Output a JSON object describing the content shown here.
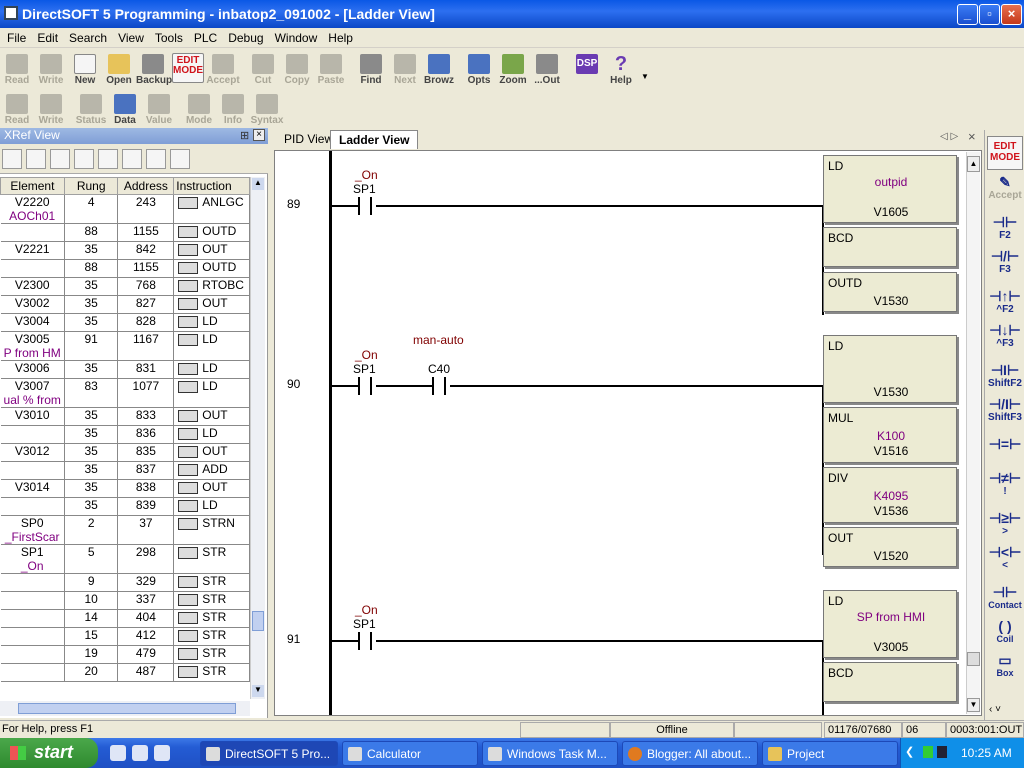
{
  "window": {
    "title": "DirectSOFT 5 Programming - inbatop2_091002 - [Ladder View]",
    "buttons": [
      "_",
      "▫",
      "×"
    ]
  },
  "menu": [
    "File",
    "Edit",
    "Search",
    "View",
    "Tools",
    "PLC",
    "Debug",
    "Window",
    "Help"
  ],
  "toolbar1": [
    {
      "label": "Read",
      "enabled": false
    },
    {
      "label": "Write",
      "enabled": false
    },
    {
      "label": "New",
      "enabled": true
    },
    {
      "label": "Open",
      "enabled": true
    },
    {
      "label": "Backup",
      "enabled": true
    },
    {
      "label": "EDIT MODE",
      "enabled": true
    },
    {
      "label": "Accept",
      "enabled": false
    },
    {
      "label": "Cut",
      "enabled": false
    },
    {
      "label": "Copy",
      "enabled": false
    },
    {
      "label": "Paste",
      "enabled": false
    },
    {
      "label": "Find",
      "enabled": true
    },
    {
      "label": "Next",
      "enabled": false
    },
    {
      "label": "Browz",
      "enabled": true
    },
    {
      "label": "Opts",
      "enabled": true
    },
    {
      "label": "Zoom",
      "enabled": true
    },
    {
      "label": "...Out",
      "enabled": true
    },
    {
      "label": "DSP",
      "enabled": true
    },
    {
      "label": "Help",
      "enabled": true
    }
  ],
  "toolbar2": [
    {
      "label": "Read",
      "enabled": false
    },
    {
      "label": "Write",
      "enabled": false
    },
    {
      "label": "Status",
      "enabled": false
    },
    {
      "label": "Data",
      "enabled": true
    },
    {
      "label": "Value",
      "enabled": false
    },
    {
      "label": "Mode",
      "enabled": false
    },
    {
      "label": "Info",
      "enabled": false
    },
    {
      "label": "Syntax",
      "enabled": false
    }
  ],
  "xref": {
    "title": "XRef View",
    "columns": [
      "Element",
      "Rung",
      "Address",
      "Instruction"
    ],
    "rows": [
      {
        "element": "V2220",
        "nick": "AOCh01",
        "rung": "4",
        "addr": "243",
        "instr": "ANLGC"
      },
      {
        "element": "",
        "nick": "",
        "rung": "88",
        "addr": "1155",
        "instr": "OUTD"
      },
      {
        "element": "V2221",
        "nick": "",
        "rung": "35",
        "addr": "842",
        "instr": "OUT"
      },
      {
        "element": "",
        "nick": "",
        "rung": "88",
        "addr": "1155",
        "instr": "OUTD"
      },
      {
        "element": "V2300",
        "nick": "",
        "rung": "35",
        "addr": "768",
        "instr": "RTOBC"
      },
      {
        "element": "V3002",
        "nick": "",
        "rung": "35",
        "addr": "827",
        "instr": "OUT"
      },
      {
        "element": "V3004",
        "nick": "",
        "rung": "35",
        "addr": "828",
        "instr": "LD"
      },
      {
        "element": "V3005",
        "nick": "P from HM",
        "rung": "91",
        "addr": "1167",
        "instr": "LD"
      },
      {
        "element": "V3006",
        "nick": "",
        "rung": "35",
        "addr": "831",
        "instr": "LD"
      },
      {
        "element": "V3007",
        "nick": "ual % from",
        "rung": "83",
        "addr": "1077",
        "instr": "LD"
      },
      {
        "element": "V3010",
        "nick": "",
        "rung": "35",
        "addr": "833",
        "instr": "OUT"
      },
      {
        "element": "",
        "nick": "",
        "rung": "35",
        "addr": "836",
        "instr": "LD"
      },
      {
        "element": "V3012",
        "nick": "",
        "rung": "35",
        "addr": "835",
        "instr": "OUT"
      },
      {
        "element": "",
        "nick": "",
        "rung": "35",
        "addr": "837",
        "instr": "ADD"
      },
      {
        "element": "V3014",
        "nick": "",
        "rung": "35",
        "addr": "838",
        "instr": "OUT"
      },
      {
        "element": "",
        "nick": "",
        "rung": "35",
        "addr": "839",
        "instr": "LD"
      },
      {
        "element": "SP0",
        "nick": "_FirstScar",
        "rung": "2",
        "addr": "37",
        "instr": "STRN"
      },
      {
        "element": "SP1",
        "nick": "_On",
        "rung": "5",
        "addr": "298",
        "instr": "STR"
      },
      {
        "element": "",
        "nick": "",
        "rung": "9",
        "addr": "329",
        "instr": "STR"
      },
      {
        "element": "",
        "nick": "",
        "rung": "10",
        "addr": "337",
        "instr": "STR"
      },
      {
        "element": "",
        "nick": "",
        "rung": "14",
        "addr": "404",
        "instr": "STR"
      },
      {
        "element": "",
        "nick": "",
        "rung": "15",
        "addr": "412",
        "instr": "STR"
      },
      {
        "element": "",
        "nick": "",
        "rung": "19",
        "addr": "479",
        "instr": "STR"
      },
      {
        "element": "",
        "nick": "",
        "rung": "20",
        "addr": "487",
        "instr": "STR"
      }
    ]
  },
  "tabs": [
    "PID View",
    "Ladder View"
  ],
  "ladder": {
    "rung89": {
      "num": "89",
      "contact_nick": "_On",
      "contact": "SP1",
      "boxes": [
        {
          "op": "LD",
          "p1": "outpid",
          "p2": "V1605"
        },
        {
          "op": "BCD",
          "p1": "",
          "p2": ""
        },
        {
          "op": "OUTD",
          "p1": "",
          "p2": "V1530"
        }
      ]
    },
    "rung90": {
      "num": "90",
      "contact_nick": "_On",
      "contact": "SP1",
      "c2_nick": "man-auto",
      "c2": "C40",
      "boxes": [
        {
          "op": "LD",
          "p1": "",
          "p2": "V1530"
        },
        {
          "op": "MUL",
          "p1": "K100",
          "p2": "V1516"
        },
        {
          "op": "DIV",
          "p1": "K4095",
          "p2": "V1536"
        },
        {
          "op": "OUT",
          "p1": "",
          "p2": "V1520"
        }
      ]
    },
    "rung91": {
      "num": "91",
      "contact_nick": "_On",
      "contact": "SP1",
      "boxes": [
        {
          "op": "LD",
          "p1": "SP from HMI",
          "p2": "V3005"
        },
        {
          "op": "BCD",
          "p1": "",
          "p2": ""
        }
      ]
    }
  },
  "rightbar": [
    "EDIT MODE",
    "Accept",
    "F2",
    "F3",
    "^F2",
    "^F3",
    "ShiftF2",
    "ShiftF3",
    "=",
    "!",
    "",
    ">",
    "<",
    "Contact",
    "Coil",
    "Box"
  ],
  "status": {
    "help": "For Help, press F1",
    "mode": "Offline",
    "position": "01176/07680",
    "rung": "06",
    "address": "0003:001:OUT"
  },
  "taskbar": {
    "start": "start",
    "tasks": [
      "DirectSOFT 5 Pro...",
      "Calculator",
      "Windows Task M...",
      "Blogger: All about...",
      "Project"
    ],
    "time": "10:25 AM"
  }
}
